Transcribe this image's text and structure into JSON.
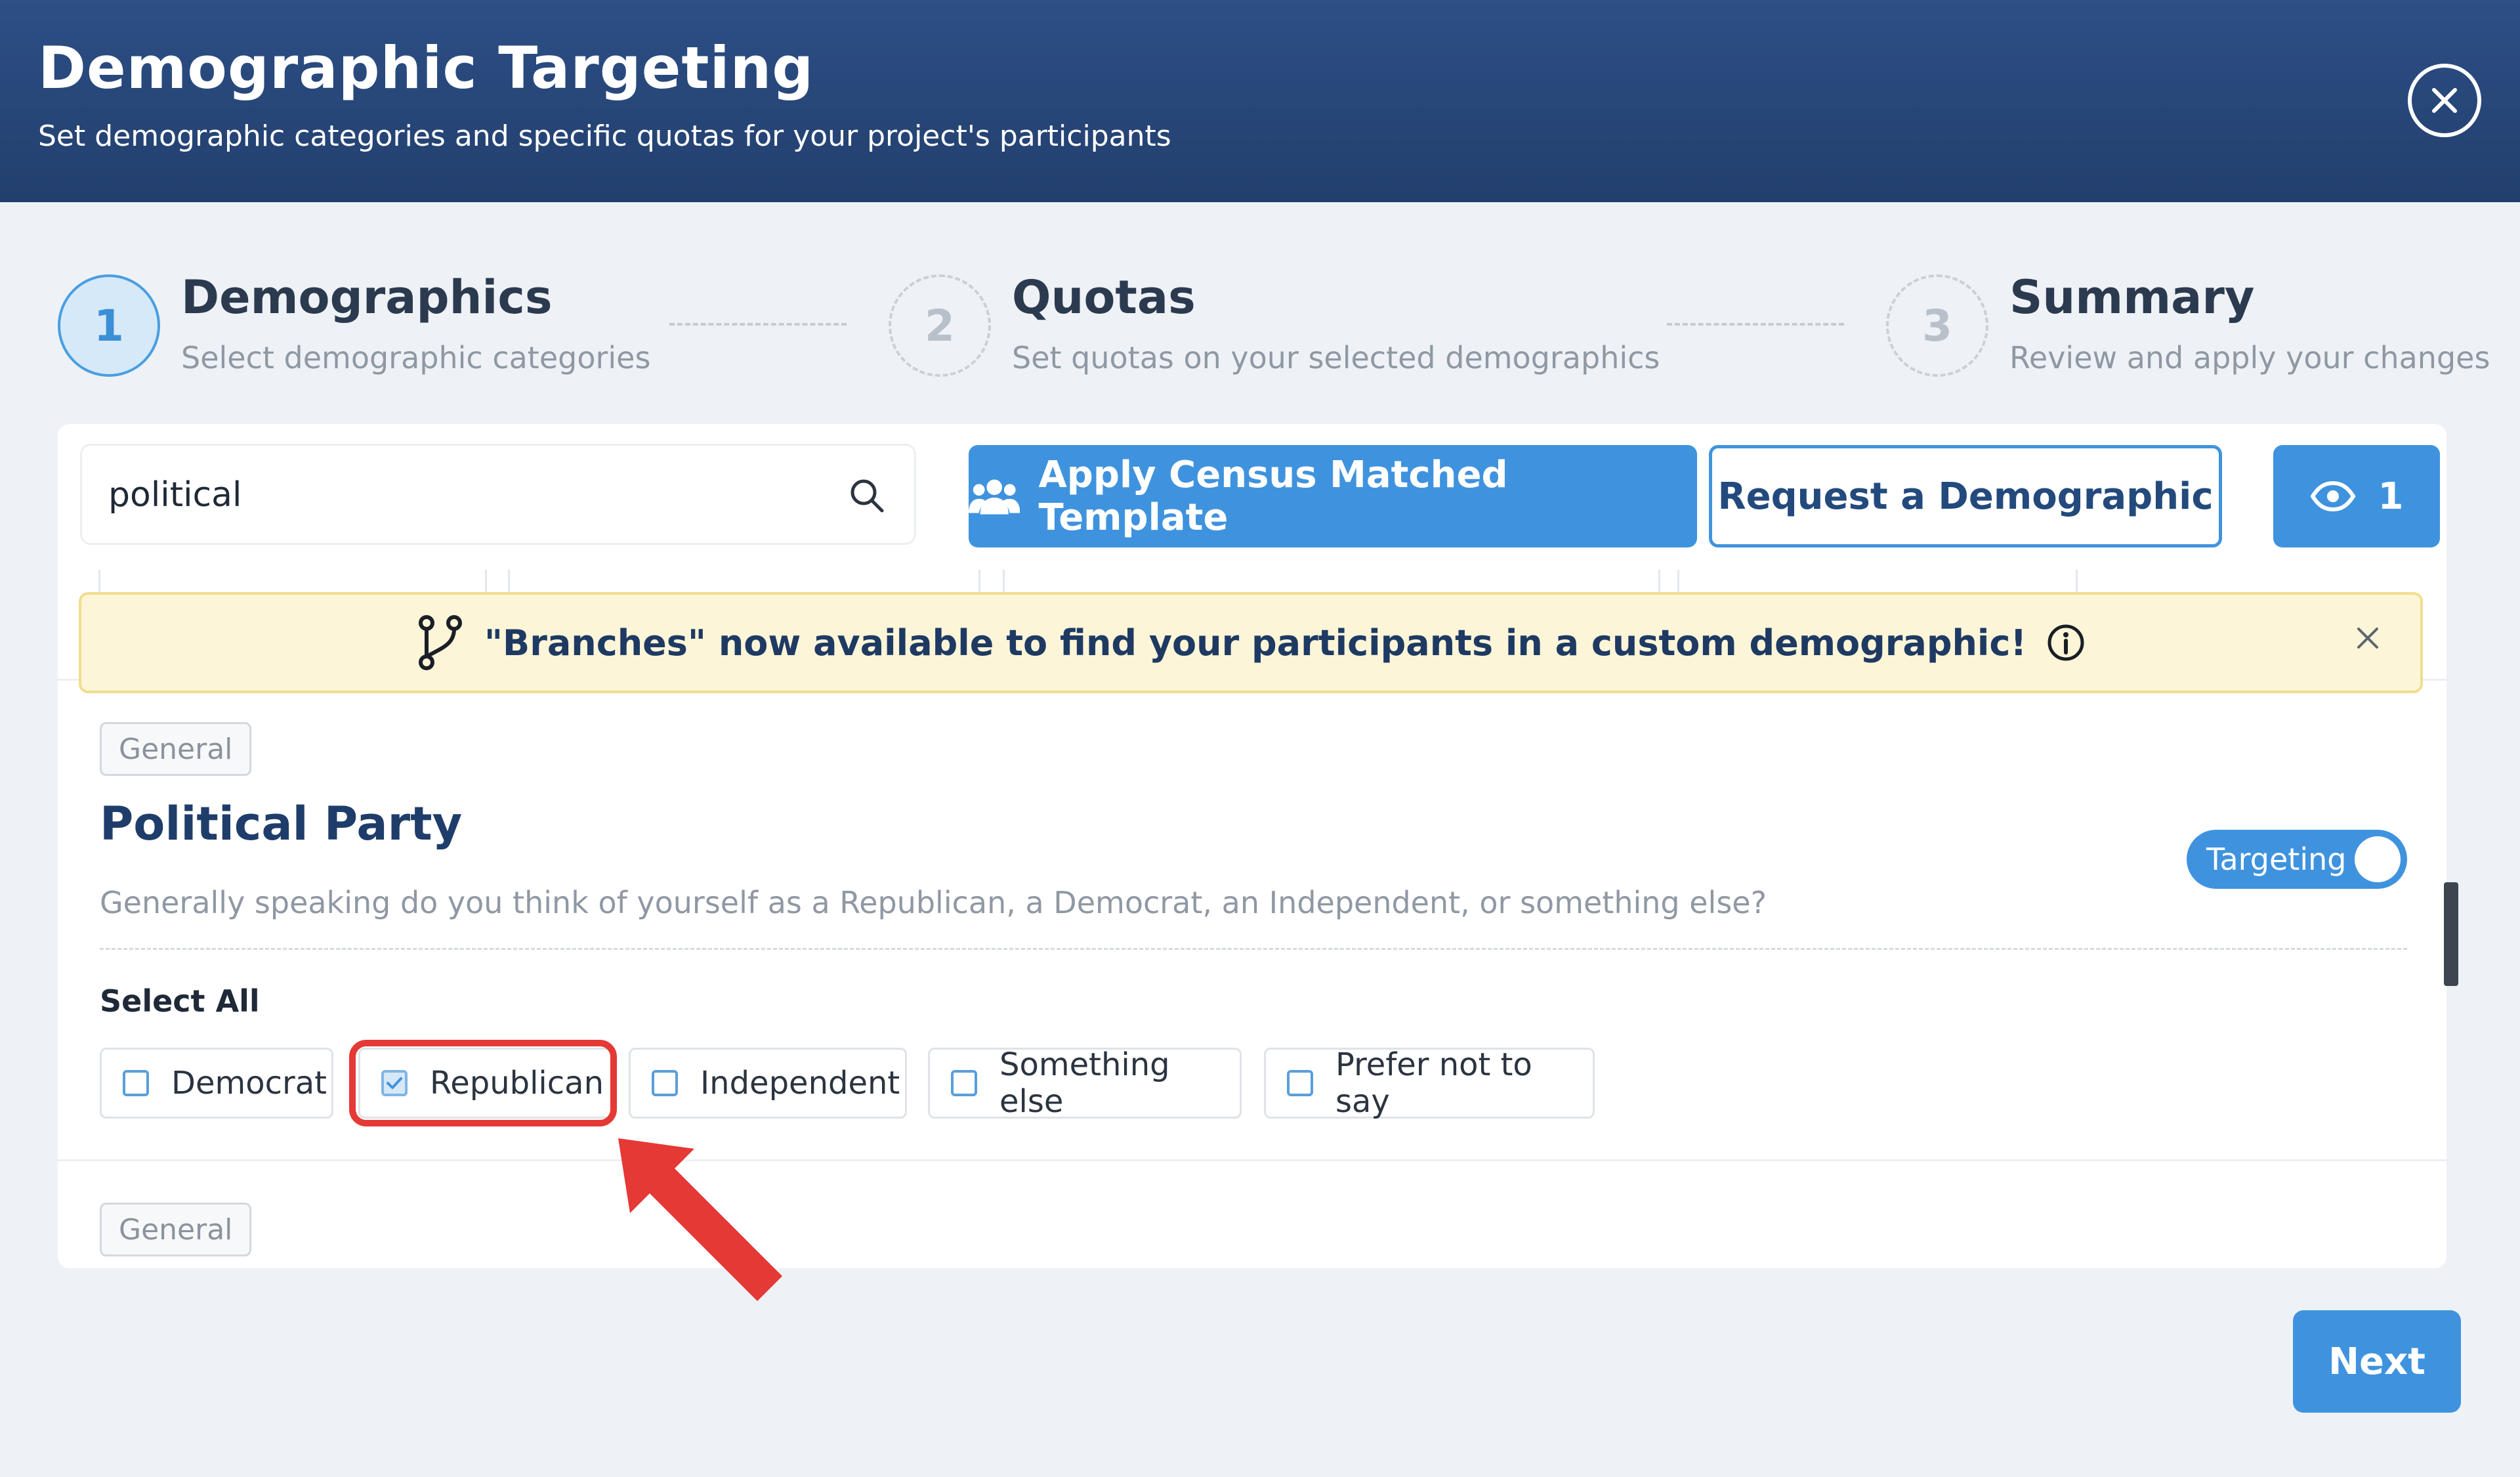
{
  "header": {
    "title": "Demographic Targeting",
    "subtitle": "Set demographic categories and specific quotas for your project's participants"
  },
  "steps": [
    {
      "number": "1",
      "title": "Demographics",
      "subtitle": "Select demographic categories",
      "state": "active"
    },
    {
      "number": "2",
      "title": "Quotas",
      "subtitle": "Set quotas on your selected demographics",
      "state": "inactive"
    },
    {
      "number": "3",
      "title": "Summary",
      "subtitle": "Review and apply your changes",
      "state": "inactive"
    }
  ],
  "toolbar": {
    "search_value": "political",
    "apply_template_label": "Apply Census Matched Template",
    "request_label": "Request a Demographic",
    "selected_count": "1"
  },
  "banner": {
    "text": "\"Branches\" now available to find your participants in a custom demographic!"
  },
  "section": {
    "tag": "General",
    "title": "Political Party",
    "question": "Generally speaking do you think of yourself as a Republican, a Democrat, an Independent, or something else?",
    "toggle_label": "Targeting",
    "select_all_label": "Select All",
    "options": [
      {
        "label": "Democrat",
        "checked": false
      },
      {
        "label": "Republican",
        "checked": true
      },
      {
        "label": "Independent",
        "checked": false
      },
      {
        "label": "Something else",
        "checked": false
      },
      {
        "label": "Prefer not to say",
        "checked": false
      }
    ]
  },
  "next_section": {
    "tag": "General"
  },
  "footer": {
    "next_label": "Next"
  },
  "colors": {
    "header": "#2d4f86",
    "primary": "#3f93de",
    "annotation": "#e53935"
  }
}
